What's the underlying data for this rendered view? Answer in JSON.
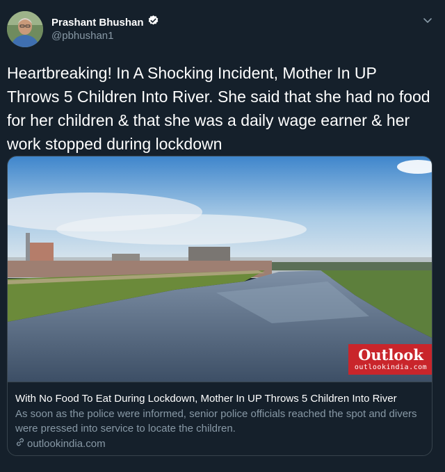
{
  "tweet": {
    "author_name": "Prashant Bhushan",
    "handle": "@pbhushan1",
    "text": "Heartbreaking! In A Shocking Incident, Mother In UP Throws 5 Children Into River. She said that she had no food for her children & that she was a daily wage earner & her work stopped during lockdown"
  },
  "card": {
    "badge_name": "Outlook",
    "badge_site": "outlookindia.com",
    "title": "With No Food To Eat During Lockdown, Mother In UP Throws 5 Children Into River",
    "description": "As soon as the police were informed, senior police officials reached the spot and divers were pressed into service to locate the children.",
    "domain": "outlookindia.com"
  },
  "icons": {
    "verified": "verified-badge-icon",
    "chevron": "chevron-down-icon",
    "link": "link-icon"
  },
  "colors": {
    "background": "#15202b",
    "secondary_text": "#8899a6",
    "border": "#38444d",
    "verified_blue": "#1da1f2",
    "badge_red": "#c9252b"
  }
}
